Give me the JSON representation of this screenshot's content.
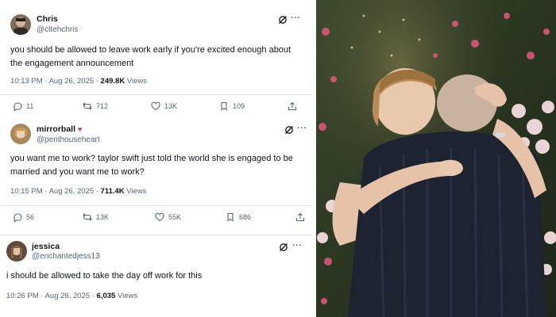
{
  "tweets": [
    {
      "name": "Chris",
      "handle": "@cltehchris",
      "text": "you should be allowed to leave work early if you're excited enough about the engagement announcement",
      "time": "10:13 PM · Aug 26, 2025 · ",
      "views_count": "249.8K",
      "views_label": " Views",
      "replies": "11",
      "reposts": "712",
      "likes": "13K",
      "bookmarks": "109"
    },
    {
      "name": "mirrorball",
      "badge": "♥",
      "handle": "@penthouseheart",
      "text": "you want me to work? taylor swift just told the world she is engaged to be married and you want me to work?",
      "time": "10:15 PM · Aug 26, 2025 · ",
      "views_count": "711.4K",
      "views_label": " Views",
      "replies": "56",
      "reposts": "13K",
      "likes": "55K",
      "bookmarks": "686"
    },
    {
      "name": "jessica",
      "handle": "@enchantedjess13",
      "text": "i should be allowed to take the day off work for this",
      "time": "10:26 PM · Aug 26, 2025 · ",
      "views_count": "6,035",
      "views_label": " Views"
    }
  ],
  "icons": {
    "more": "···"
  },
  "colors": {
    "text": "#0f1419",
    "secondary": "#536471",
    "divider": "#dfe4e8",
    "badge": "#e0245e"
  }
}
